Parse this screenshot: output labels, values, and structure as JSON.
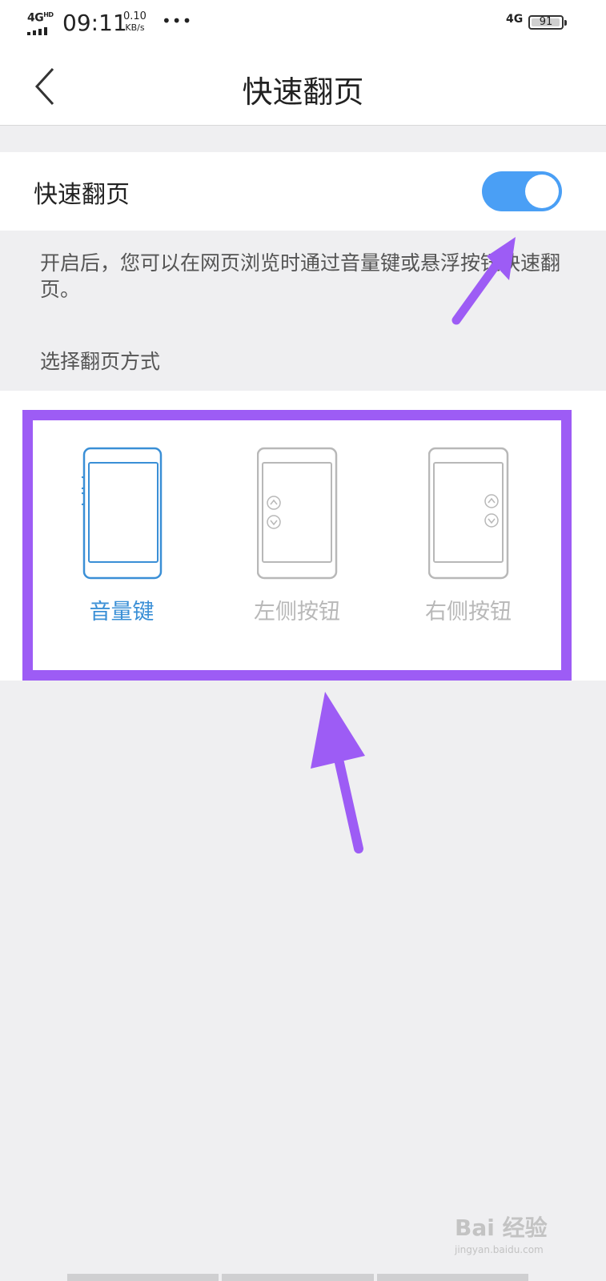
{
  "status_bar": {
    "network_left": "4G",
    "network_left_sup": "HD",
    "time": "09:11",
    "speed_value": "0.10",
    "speed_unit": "KB/s",
    "more": "•••",
    "network_right": "4G",
    "battery": "91"
  },
  "header": {
    "back_icon": "chevron-left-icon",
    "title": "快速翻页"
  },
  "setting": {
    "label": "快速翻页",
    "toggle_on": true,
    "toggle_color": "#4a9ff5"
  },
  "description": "开启后，您可以在网页浏览时通过音量键或悬浮按钮快速翻页。",
  "section_label": "选择翻页方式",
  "options": [
    {
      "label": "音量键",
      "selected": true,
      "icon": "phone-volume-keys-icon"
    },
    {
      "label": "左侧按钮",
      "selected": false,
      "icon": "phone-left-buttons-icon"
    },
    {
      "label": "右侧按钮",
      "selected": false,
      "icon": "phone-right-buttons-icon"
    }
  ],
  "colors": {
    "accent": "#3a8fd6",
    "annotation": "#9d5cf5",
    "inactive": "#b8b8b8"
  },
  "watermark": {
    "text": "Bai 经验",
    "sub": "jingyan.baidu.com"
  }
}
